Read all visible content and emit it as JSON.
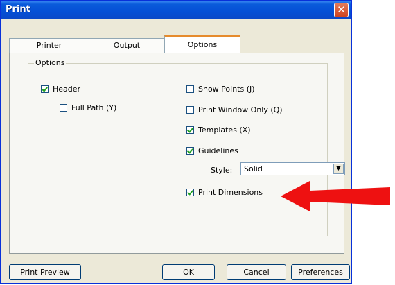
{
  "window": {
    "title": "Print"
  },
  "tabs": [
    {
      "label": "Printer"
    },
    {
      "label": "Output"
    },
    {
      "label": "Options"
    }
  ],
  "options_group": {
    "label": "Options",
    "header": {
      "label": "Header",
      "checked": true
    },
    "full_path": {
      "label": "Full Path (Y)",
      "checked": false
    },
    "show_points": {
      "label": "Show Points (J)",
      "checked": false
    },
    "print_window_only": {
      "label": "Print Window Only (Q)",
      "checked": false
    },
    "templates": {
      "label": "Templates (X)",
      "checked": true
    },
    "guidelines": {
      "label": "Guidelines",
      "checked": true
    },
    "style": {
      "label": "Style:",
      "value": "Solid"
    },
    "print_dimensions": {
      "label": "Print Dimensions",
      "checked": true
    }
  },
  "buttons": {
    "print_preview": "Print Preview",
    "ok": "OK",
    "cancel": "Cancel",
    "preferences": "Preferences"
  },
  "colors": {
    "titlebar": "#0550d6",
    "annotation_arrow": "#ee1111",
    "check": "#21a121"
  }
}
